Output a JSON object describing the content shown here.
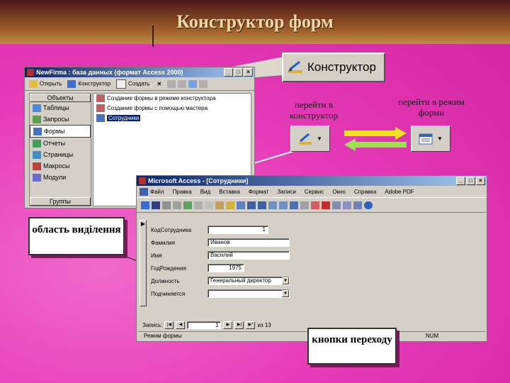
{
  "page": {
    "title": "Конструктор форм"
  },
  "constructor_button": {
    "label": "Конструктор"
  },
  "db_window": {
    "title": "NewFirma : база данных (формат Access 2000)",
    "toolbar": {
      "open": "Открыть",
      "design": "Конструктор",
      "create": "Создать"
    },
    "groups_header": "Объекты",
    "objects": [
      "Таблицы",
      "Запросы",
      "Формы",
      "Отчеты",
      "Страницы",
      "Макросы",
      "Модули"
    ],
    "groups_footer": "Группы",
    "list": [
      "Создание формы в режиме конструктора",
      "Создание формы с помощью мастера",
      "Сотрудники"
    ]
  },
  "labels": {
    "to_design": "перейти в конструктор",
    "to_form": "перейти в режим форми",
    "selection_area": "область виділення",
    "nav_buttons": "кнопки переходу"
  },
  "form_window": {
    "title": "Microsoft Access - [Сотрудники]",
    "menu": [
      "Файл",
      "Правка",
      "Вид",
      "Вставка",
      "Формат",
      "Записи",
      "Сервис",
      "Окно",
      "Справка",
      "Adobe PDF"
    ],
    "fields": [
      {
        "label": "КодСотрудника",
        "value": "1"
      },
      {
        "label": "Фамилия",
        "value": "Иванов"
      },
      {
        "label": "Имя",
        "value": "Василий"
      },
      {
        "label": "ГодРождения",
        "value": "1975"
      },
      {
        "label": "Должность",
        "value": "Генеральный директор"
      },
      {
        "label": "Подчиняется",
        "value": ""
      }
    ],
    "nav": {
      "label": "Запись:",
      "current": "1",
      "total": "из 13"
    },
    "status": {
      "mode": "Режим формы",
      "num": "NUM"
    }
  },
  "colors": {
    "background": "#e63bb8",
    "title_text": "#f3d7a4",
    "arrow_yellow": "#f0e020",
    "arrow_green": "#9ee050",
    "titlebar": "#0a246a"
  }
}
